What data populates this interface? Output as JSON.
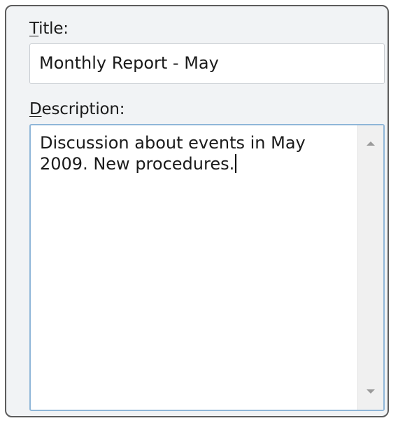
{
  "form": {
    "title_label_mnemonic": "T",
    "title_label_rest": "itle:",
    "title_value": "Monthly Report - May",
    "description_label_mnemonic": "D",
    "description_label_rest": "escription:",
    "description_value": "Discussion about events in May\n2009. New procedures."
  },
  "icons": {
    "scroll_up": "scroll-up-arrow-icon",
    "scroll_down": "scroll-down-arrow-icon"
  },
  "colors": {
    "panel_background": "#f1f3f5",
    "panel_border": "#5c5c5c",
    "focus_border": "#8fb6d8",
    "input_border": "#c9cdd2"
  }
}
